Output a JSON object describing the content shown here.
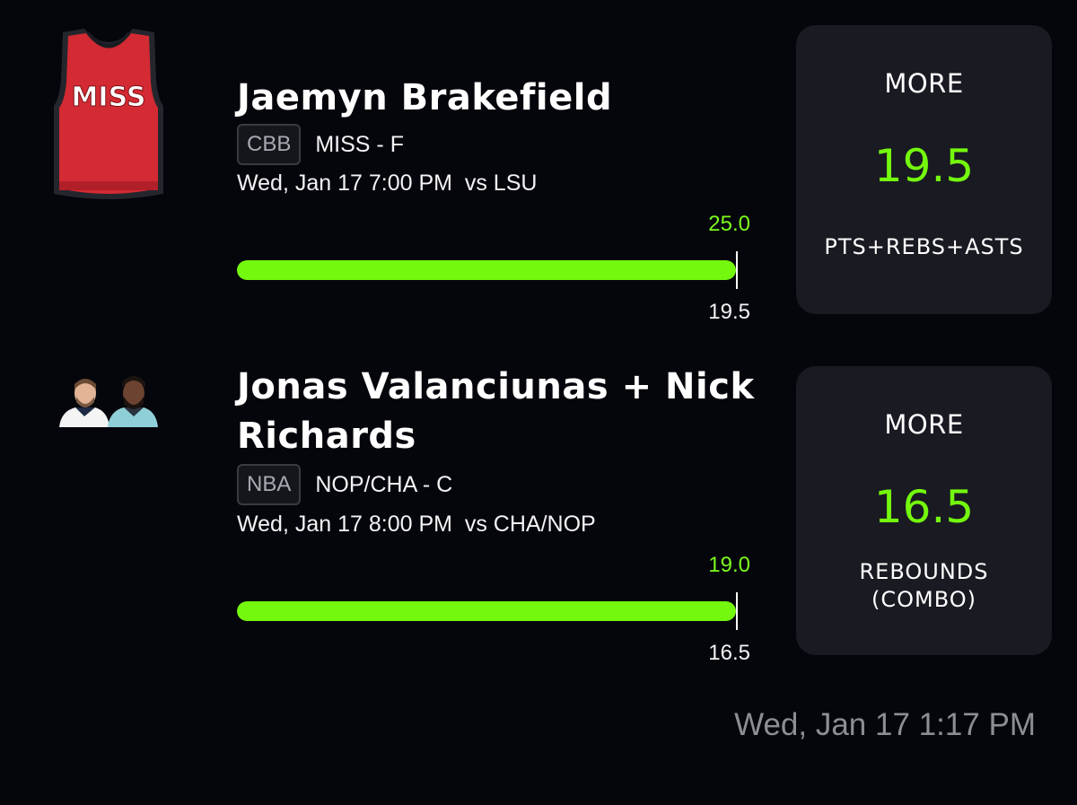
{
  "picks": [
    {
      "player_name": "Jaemyn Brakefield",
      "jersey_text": "MISS",
      "league": "CBB",
      "team_position": "MISS - F",
      "game_time": "Wed, Jan 17 7:00 PM  vs LSU",
      "actual_value": "25.0",
      "line_value": "19.5",
      "progress_fraction": 1.0,
      "direction": "MORE",
      "projection": "19.5",
      "stat_type": "PTS+REBS+ASTS"
    },
    {
      "player_name": "Jonas Valanciunas + Nick Richards",
      "league": "NBA",
      "team_position": "NOP/CHA - C",
      "game_time": "Wed, Jan 17 8:00 PM  vs CHA/NOP",
      "actual_value": "19.0",
      "line_value": "16.5",
      "progress_fraction": 1.0,
      "direction": "MORE",
      "projection": "16.5",
      "stat_type": "REBOUNDS\n(COMBO)"
    }
  ],
  "timestamp": "Wed, Jan 17 1:17 PM",
  "colors": {
    "background": "#05060c",
    "accent_green": "#74f80d",
    "card": "#191a22",
    "jersey_red": "#d42a33"
  }
}
